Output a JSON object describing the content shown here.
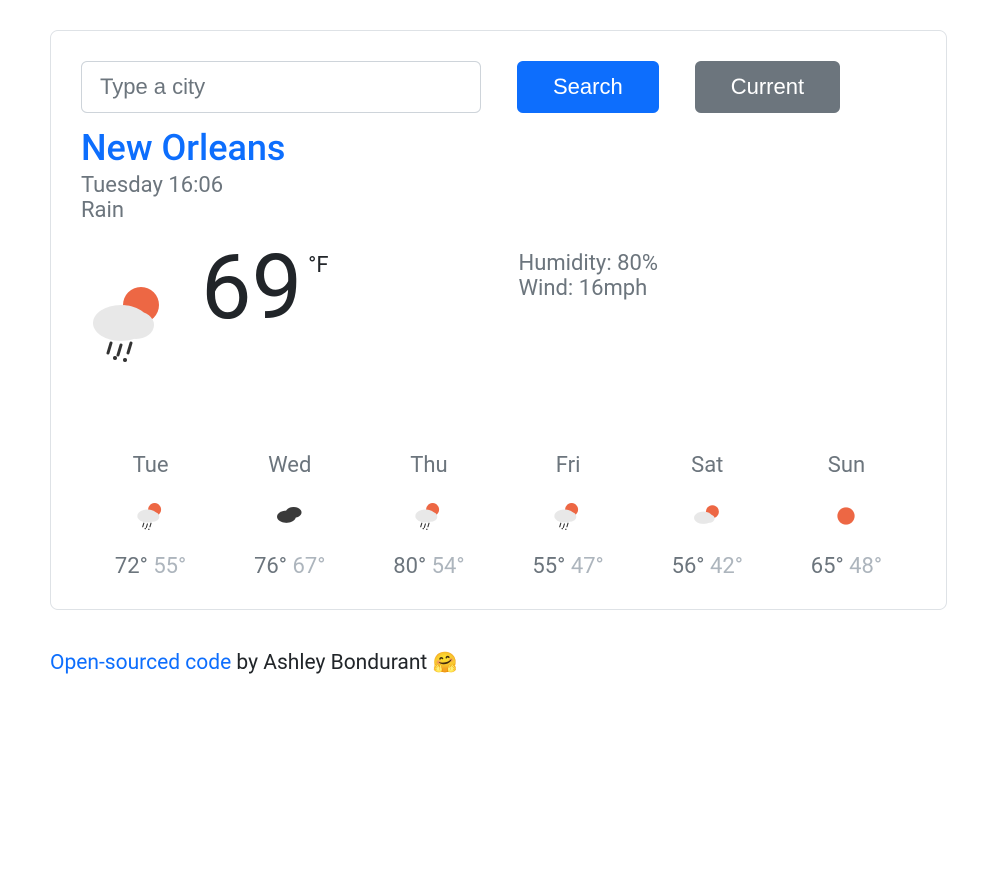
{
  "search": {
    "placeholder": "Type a city",
    "search_label": "Search",
    "current_label": "Current"
  },
  "current": {
    "city": "New Orleans",
    "datetime": "Tuesday 16:06",
    "condition": "Rain",
    "temp": "69",
    "unit": "°F",
    "humidity_label": "Humidity: ",
    "humidity_value": "80%",
    "wind_label": "Wind: ",
    "wind_value": "16mph",
    "icon": "rain-sun"
  },
  "forecast": [
    {
      "day": "Tue",
      "high": "72°",
      "low": "55°",
      "icon": "rain-sun"
    },
    {
      "day": "Wed",
      "high": "76°",
      "low": "67°",
      "icon": "cloudy-dark"
    },
    {
      "day": "Thu",
      "high": "80°",
      "low": "54°",
      "icon": "rain-sun"
    },
    {
      "day": "Fri",
      "high": "55°",
      "low": "47°",
      "icon": "rain-sun"
    },
    {
      "day": "Sat",
      "high": "56°",
      "low": "42°",
      "icon": "cloud-sun"
    },
    {
      "day": "Sun",
      "high": "65°",
      "low": "48°",
      "icon": "sun"
    }
  ],
  "footer": {
    "link_text": "Open-sourced code",
    "by_text": " by Ashley Bondurant ",
    "emoji": "🤗"
  },
  "colors": {
    "primary": "#0d6efd",
    "secondary": "#6c757d",
    "sun": "#ed6744",
    "cloud": "#e8e8e8",
    "darkcloud": "#3a3a3a"
  }
}
